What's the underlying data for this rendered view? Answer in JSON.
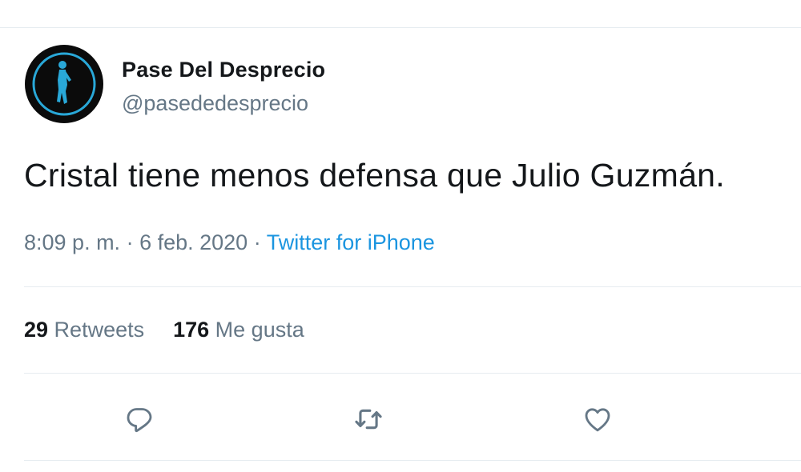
{
  "tweet": {
    "author": {
      "display_name": "Pase Del Desprecio",
      "handle": "@pasededesprecio",
      "avatar_icon": "silhouette-icon"
    },
    "text": "Cristal tiene menos defensa que Julio Guzmán.",
    "time": "8:09 p. m.",
    "separator_1": " · ",
    "date": "6 feb. 2020",
    "separator_2": " · ",
    "source": "Twitter for iPhone",
    "stats": {
      "retweets_count": "29",
      "retweets_label": " Retweets",
      "likes_count": "176",
      "likes_label": " Me gusta"
    },
    "actions": {
      "reply_icon": "reply-icon",
      "retweet_icon": "retweet-icon",
      "like_icon": "heart-icon"
    }
  },
  "colors": {
    "text_primary": "#14171a",
    "text_secondary": "#657786",
    "link": "#1b95e0",
    "divider": "#e6ecf0",
    "avatar_accent": "#29a8d8"
  }
}
